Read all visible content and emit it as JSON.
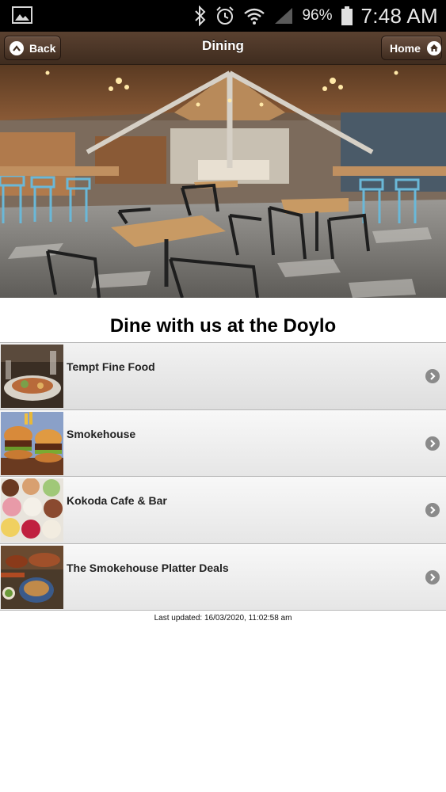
{
  "status_bar": {
    "icons": [
      "image-icon",
      "bluetooth-icon",
      "alarm-icon",
      "wifi-icon",
      "signal-icon",
      "battery-icon"
    ],
    "battery_percent": "96%",
    "time": "7:48 AM"
  },
  "header": {
    "title": "Dining",
    "back_label": "Back",
    "home_label": "Home",
    "colors": {
      "bar": "#4a3426",
      "text": "#ffffff"
    }
  },
  "hero": {
    "icon": "restaurant-photo"
  },
  "headline": "Dine with us at the Doylo",
  "list": {
    "items": [
      {
        "label": "Tempt Fine Food",
        "icon": "tempt-fine-food-photo"
      },
      {
        "label": "Smokehouse",
        "icon": "smokehouse-burgers-photo"
      },
      {
        "label": "Kokoda Cafe & Bar",
        "icon": "kokoda-gelato-photo"
      },
      {
        "label": "The Smokehouse Platter Deals",
        "icon": "platter-deals-photo"
      }
    ],
    "arrow_icon": "chevron-right-circle-icon"
  },
  "footer": {
    "last_updated": "Last updated: 16/03/2020, 11:02:58 am"
  }
}
